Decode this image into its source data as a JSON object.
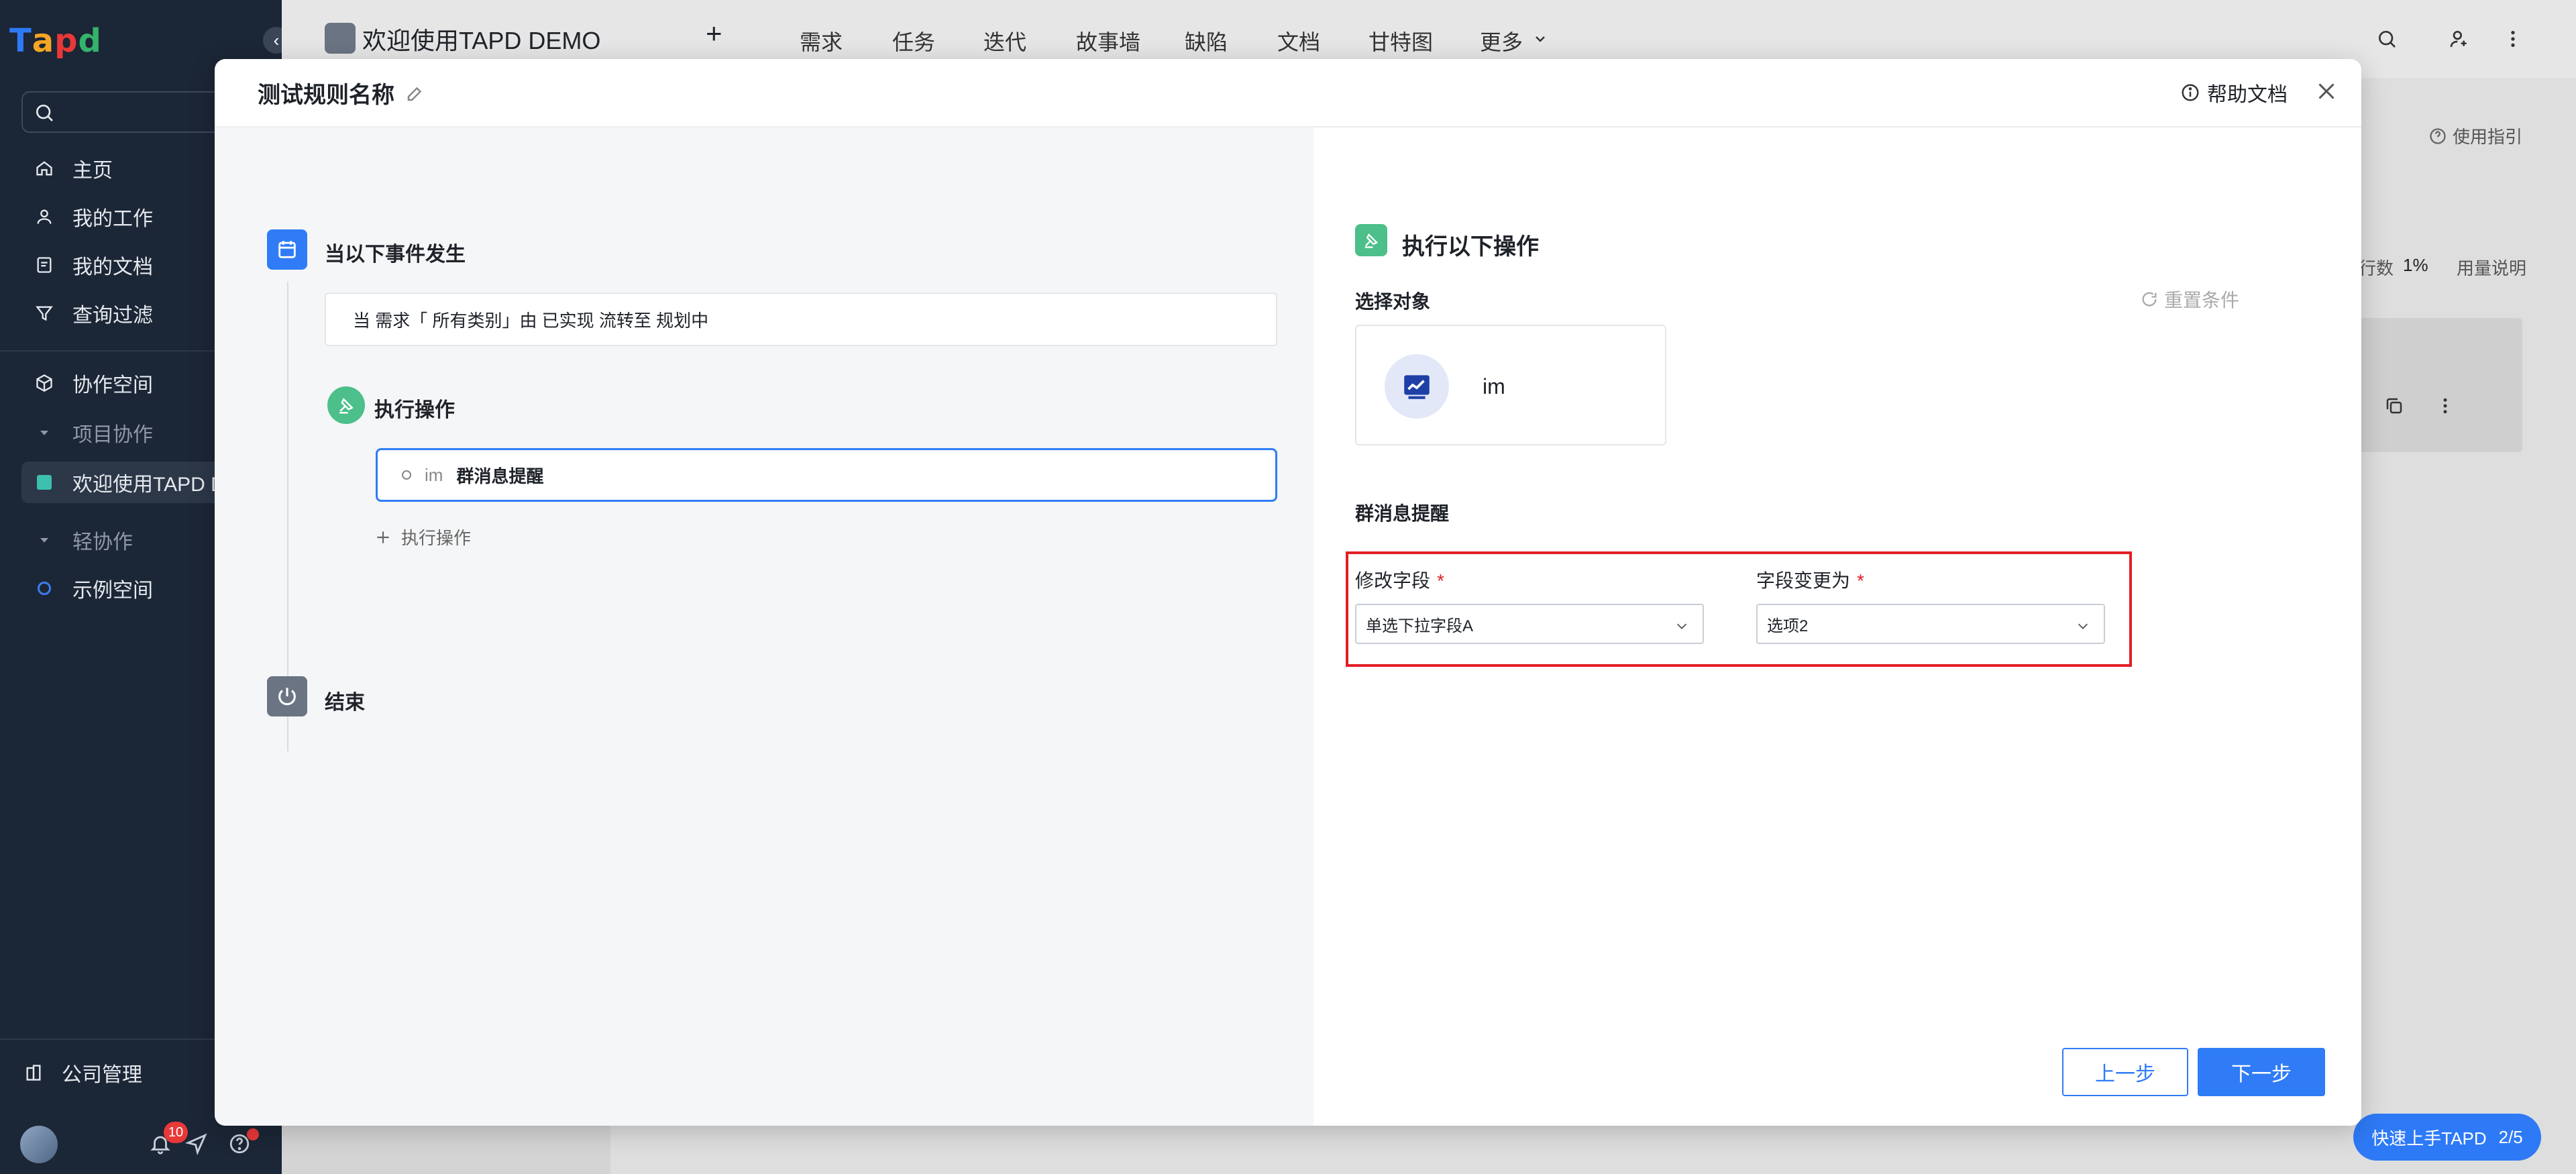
{
  "sidebar": {
    "items": [
      {
        "label": "主页",
        "icon": "home-icon"
      },
      {
        "label": "我的工作",
        "icon": "user-icon"
      },
      {
        "label": "我的文档",
        "icon": "document-icon"
      },
      {
        "label": "查询过滤",
        "icon": "filter-icon"
      },
      {
        "label": "协作空间",
        "icon": "cube-icon"
      },
      {
        "label": "项目协作",
        "icon": "caret-down-icon"
      },
      {
        "label": "欢迎使用TAPD D",
        "icon": "project-square-icon"
      },
      {
        "label": "轻协作",
        "icon": "caret-down-icon"
      },
      {
        "label": "示例空间",
        "icon": "circle-icon"
      }
    ],
    "company_label": "公司管理",
    "notification_count": "10",
    "logo_text": "Tapd"
  },
  "topbar": {
    "project_title": "欢迎使用TAPD DEMO",
    "plus": "+",
    "tabs": [
      "需求",
      "任务",
      "迭代",
      "故事墙",
      "缺陷",
      "文档",
      "甘特图",
      "更多"
    ]
  },
  "background": {
    "guide_link": "使用指引",
    "row_count_label": "行数",
    "row_count_value": "1%",
    "usage_label": "用量说明",
    "quick_start_label": "快速上手TAPD",
    "quick_start_progress": "2/5"
  },
  "modal": {
    "title": "测试规则名称",
    "help_label": "帮助文档",
    "trigger_label": "当以下事件发生",
    "trigger_condition": "当 需求「 所有类别」由 已实现 流转至 规划中",
    "action_step_label": "执行操作",
    "action_item_target": "im",
    "action_item_name": "群消息提醒",
    "add_action_label": "执行操作",
    "end_label": "结束",
    "right_title": "执行以下操作",
    "select_target_label": "选择对象",
    "reset_label": "重置条件",
    "target_name": "im",
    "group_label": "群消息提醒",
    "field_label": "修改字段",
    "field_value": "单选下拉字段A",
    "change_label": "字段变更为",
    "change_value": "选项2",
    "required_mark": "*",
    "prev_button": "上一步",
    "next_button": "下一步"
  },
  "colors": {
    "sidebar_bg": "#1b2636",
    "primary": "#2f7cf6",
    "highlight_frame": "#e21f26",
    "action_green": "#4cbf8a"
  }
}
